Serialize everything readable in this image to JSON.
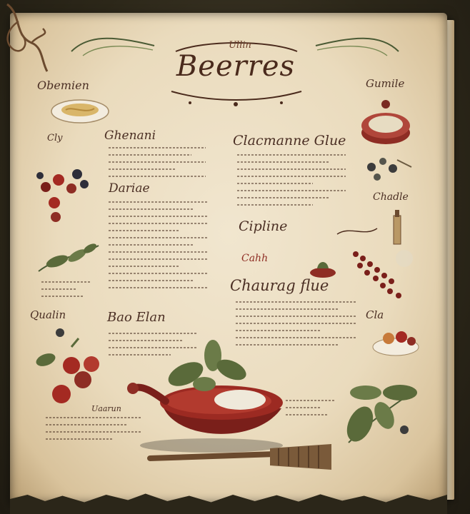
{
  "book": {
    "title": "Beerres",
    "title_top": "Ullin",
    "headings": {
      "left_top": "Ghenani",
      "left_second": "Dariae",
      "center_top": "Clacmanne Glue",
      "center_mid": "Cipline",
      "center_label_red": "Cahh",
      "center_lower": "Chaurag flue",
      "left_lower": "Bao Elan",
      "left_far": "Qualin",
      "top_left_corner": "Obemien",
      "top_right": "Gumile",
      "right_mid": "Chadle",
      "right_lower": "Cla",
      "left_small": "Cly",
      "bottom_left": "Uaarun"
    }
  },
  "colors": {
    "paper": "#eadbbd",
    "ink": "#4a2a1c",
    "accent_red": "#8e2d24",
    "leaf_green": "#5a6a3a"
  }
}
